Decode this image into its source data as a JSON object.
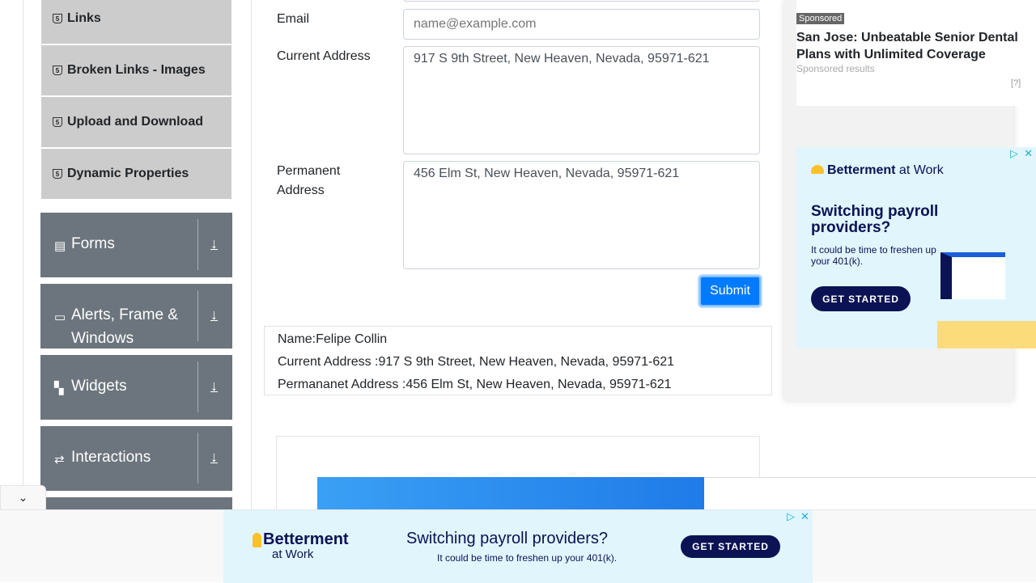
{
  "sidebar": {
    "sub_items": [
      {
        "label": "Links"
      },
      {
        "label": "Broken Links - Images"
      },
      {
        "label": "Upload and Download"
      },
      {
        "label": "Dynamic Properties"
      }
    ],
    "groups": [
      {
        "label": "Forms",
        "icon": "▤"
      },
      {
        "label": "Alerts, Frame & Windows",
        "icon": "▭"
      },
      {
        "label": "Widgets",
        "icon": "▚"
      },
      {
        "label": "Interactions",
        "icon": "⇄"
      }
    ]
  },
  "form": {
    "email_label": "Email",
    "email_placeholder": "name@example.com",
    "current_label": "Current Address",
    "current_value": "917 S 9th Street, New Heaven, Nevada, 95971-621",
    "permanent_label": "Permanent Address",
    "permanent_value": "456 Elm St, New Heaven, Nevada, 95971-621",
    "submit": "Submit"
  },
  "output": {
    "name": "Name:Felipe Collin",
    "current": "Current Address :917 S 9th Street, New Heaven, Nevada, 95971-621",
    "permanent": "Permananet Address :456 Elm St, New Heaven, Nevada, 95971-621"
  },
  "ads": {
    "sponsored_badge": "Sponsored",
    "sponsored_title": "San Jose: Unbeatable Senior Dental Plans with Unlimited Coverage",
    "sponsored_sub": "Sponsored results",
    "help": "[?]",
    "brand": "Betterment",
    "brand_suffix": "at Work",
    "headline": "Switching payroll providers?",
    "body": "It could be time to freshen up your 401(k).",
    "cta": "GET STARTED"
  },
  "colors": {
    "primary": "#007bff",
    "sidebar_group": "#6c757d",
    "sidebar_item": "#cccccc",
    "ad_navy": "#0b1354"
  }
}
